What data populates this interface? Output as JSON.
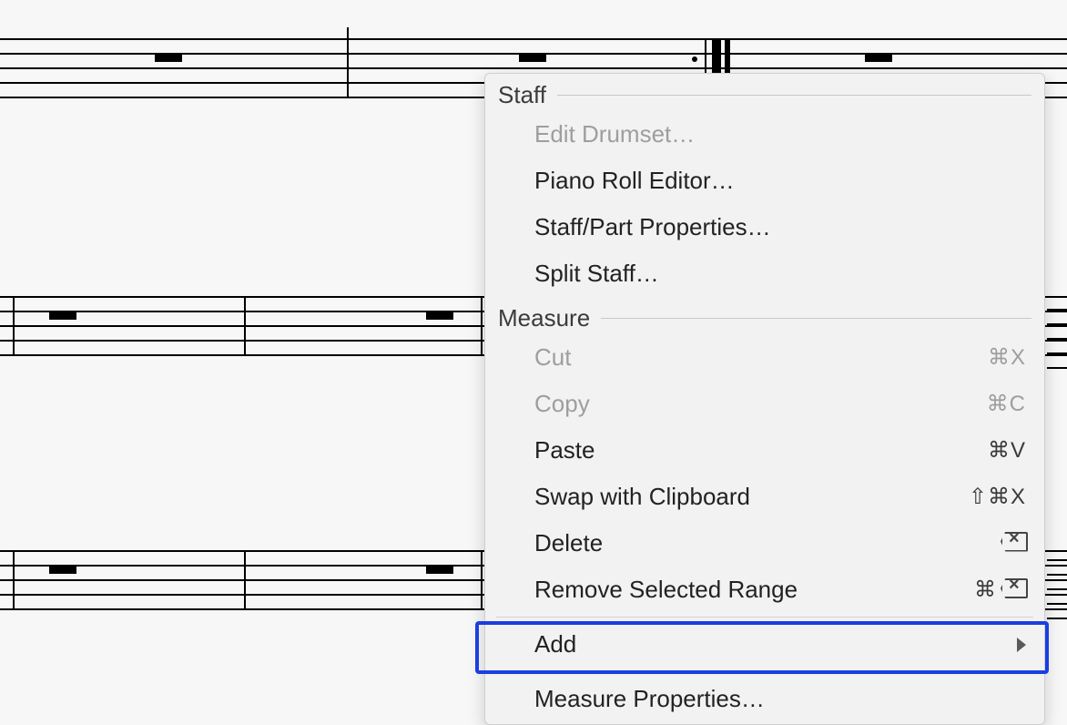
{
  "menu": {
    "sections": {
      "staff": {
        "title": "Staff",
        "items": {
          "edit_drumset": {
            "label": "Edit Drumset…",
            "enabled": false
          },
          "piano_roll": {
            "label": "Piano Roll Editor…",
            "enabled": true
          },
          "staff_part": {
            "label": "Staff/Part Properties…",
            "enabled": true
          },
          "split_staff": {
            "label": "Split Staff…",
            "enabled": true
          }
        }
      },
      "measure": {
        "title": "Measure",
        "items": {
          "cut": {
            "label": "Cut",
            "enabled": false,
            "shortcut": "⌘X"
          },
          "copy": {
            "label": "Copy",
            "enabled": false,
            "shortcut": "⌘C"
          },
          "paste": {
            "label": "Paste",
            "enabled": true,
            "shortcut": "⌘V"
          },
          "swap": {
            "label": "Swap with Clipboard",
            "enabled": true,
            "shortcut": "⇧⌘X"
          },
          "delete": {
            "label": "Delete",
            "enabled": true,
            "icon": "delete-x"
          },
          "remove_range": {
            "label": "Remove Selected Range",
            "enabled": true,
            "shortcut_icon": "⌘",
            "icon": "delete-x"
          },
          "add": {
            "label": "Add",
            "enabled": true,
            "submenu": true
          },
          "measure_props": {
            "label": "Measure Properties…",
            "enabled": true,
            "highlight": true
          }
        }
      }
    }
  }
}
